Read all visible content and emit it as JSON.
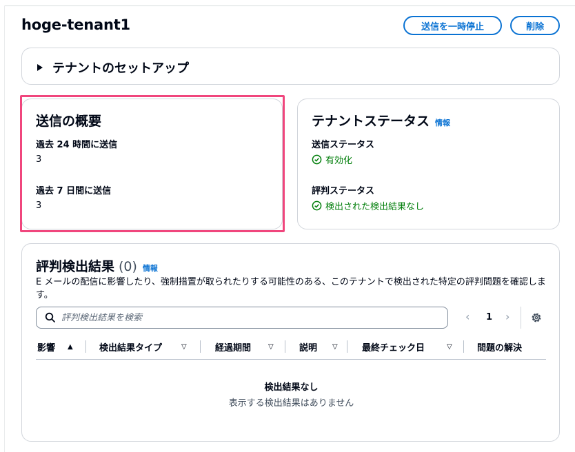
{
  "header": {
    "title": "hoge-tenant1",
    "pause_label": "送信を一時停止",
    "delete_label": "削除"
  },
  "setup": {
    "label": "テナントのセットアップ"
  },
  "summary": {
    "title": "送信の概要",
    "items": [
      {
        "label": "過去 24 時間に送信",
        "value": "3"
      },
      {
        "label": "過去 7 日間に送信",
        "value": "3"
      }
    ]
  },
  "tenant_status": {
    "title": "テナントステータス",
    "info": "情報",
    "sending_label": "送信ステータス",
    "sending_value": "有効化",
    "reputation_label": "評判ステータス",
    "reputation_value": "検出された検出結果なし"
  },
  "reputation_findings": {
    "title": "評判検出結果",
    "count": "(0)",
    "info": "情報",
    "description": "E メールの配信に影響したり、強制措置が取られたりする可能性のある、このテナントで検出された特定の評判問題を確認します。",
    "search_placeholder": "評判検出結果を検索",
    "page": "1",
    "columns": [
      {
        "label": "影響",
        "sort": "▲"
      },
      {
        "label": "検出結果タイプ",
        "sort": "▽"
      },
      {
        "label": "経過期間",
        "sort": "▽"
      },
      {
        "label": "説明",
        "sort": "▽"
      },
      {
        "label": "最終チェック日",
        "sort": "▽"
      },
      {
        "label": "問題の解決",
        "sort": ""
      }
    ],
    "empty_title": "検出結果なし",
    "empty_subtitle": "表示する検出結果はありません"
  },
  "colors": {
    "accent": "#0972d3",
    "success": "#037f0c",
    "highlight": "#f0467d"
  }
}
